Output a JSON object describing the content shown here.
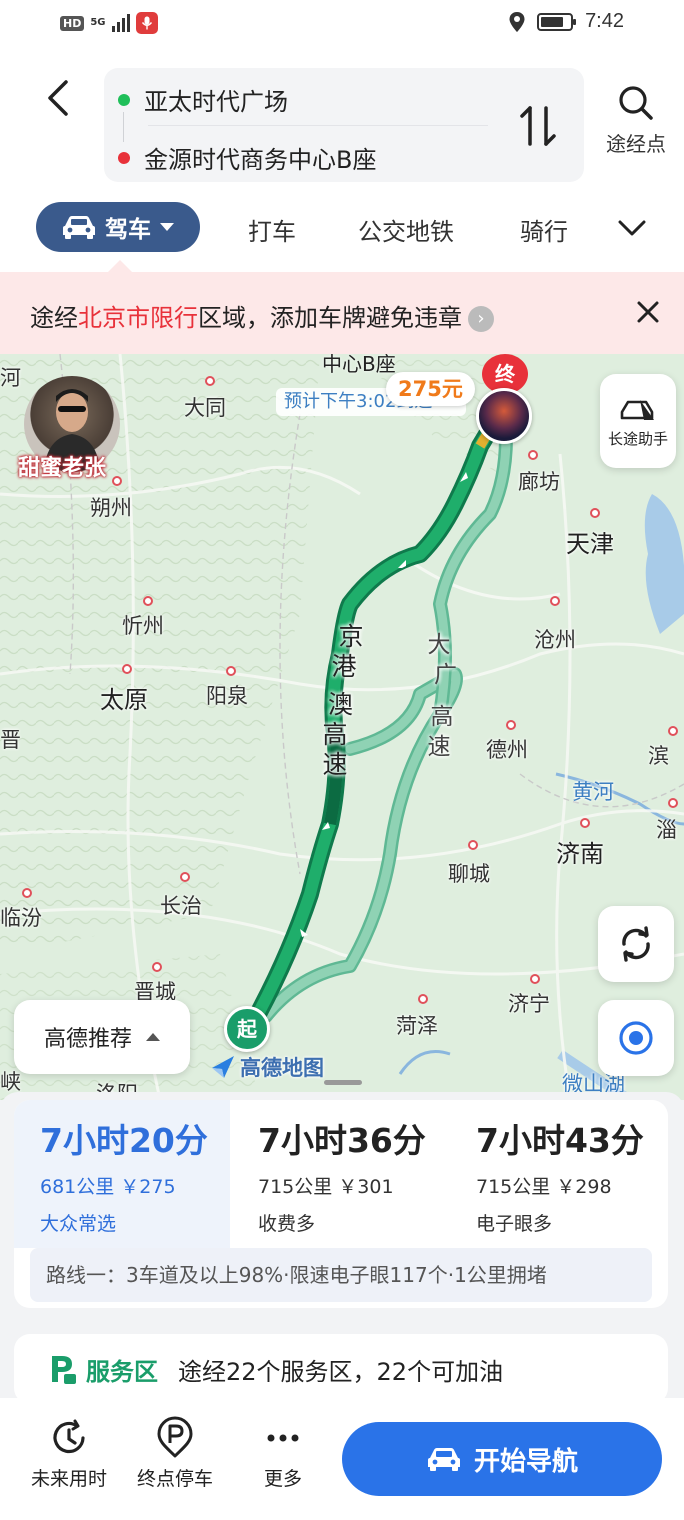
{
  "status_bar": {
    "hd": "HD",
    "network": "5G",
    "time": "7:42",
    "battery_level": 0.8,
    "icons": [
      "mic-icon",
      "location-icon",
      "battery-icon"
    ]
  },
  "header": {
    "origin": "亚太时代广场",
    "destination": "金源时代商务中心B座",
    "waypoint_label": "途经点",
    "icons": [
      "back-icon",
      "swap-icon",
      "search-icon"
    ]
  },
  "mode_tabs": {
    "active": "驾车",
    "items": [
      "打车",
      "公交地铁",
      "骑行"
    ],
    "icons": [
      "car-icon",
      "chevron-down-icon"
    ]
  },
  "banner": {
    "prefix": "途经",
    "highlight": "北京市限行",
    "suffix": "区域，添加车牌避免违章",
    "icons": [
      "arrow-right-icon",
      "close-icon"
    ]
  },
  "map": {
    "top_dest_label": "中心B座",
    "price": "275元",
    "eta": "预计下午3:02到达",
    "end_pin": "终",
    "start_pin": "起",
    "avatar_caption": "甜蜜老张",
    "long_trip_label": "长途助手",
    "route_pref": "高德推荐",
    "logo": "高德地图",
    "road_main": [
      "京",
      "港",
      "澳",
      "高",
      "速"
    ],
    "road_alt": [
      "大",
      "广",
      "高",
      "速"
    ],
    "cities": {
      "he": "河",
      "datong": "大同",
      "shuozhou": "朔州",
      "xinzhou": "忻州",
      "taiyuan": "太原",
      "yangquan": "阳泉",
      "jin": "晋",
      "linfen": "临汾",
      "changzhi": "长治",
      "jincheng": "晋城",
      "xia": "峡",
      "luoyang": "洛阳",
      "langfang": "廊坊",
      "tianjin": "天津",
      "cangzhou": "沧州",
      "dezhou": "德州",
      "bin": "滨",
      "huanghe": "黄河",
      "zi": "淄",
      "jinan": "济南",
      "liaocheng": "聊城",
      "jining": "济宁",
      "heze": "菏泽",
      "weishanhu": "微山湖"
    },
    "colors": {
      "route_main": "#1f9e64",
      "route_alt": "#6cc3a0",
      "land": "#dcebd8"
    }
  },
  "routes": [
    {
      "time": "7小时20分",
      "info": "681公里 ￥275",
      "tag": "大众常选",
      "selected": true
    },
    {
      "time": "7小时36分",
      "info": "715公里 ￥301",
      "tag": "收费多",
      "selected": false
    },
    {
      "time": "7小时43分",
      "info": "715公里 ￥298",
      "tag": "电子眼多",
      "selected": false
    }
  ],
  "route_detail": "路线一：3车道及以上98%·限速电子眼117个·1公里拥堵",
  "service": {
    "title": "服务区",
    "text": "途经22个服务区，22个可加油"
  },
  "bottom_bar": {
    "future": "未来用时",
    "parking": "终点停车",
    "more": "更多",
    "start": "开始导航",
    "accent": "#2a73e8"
  }
}
